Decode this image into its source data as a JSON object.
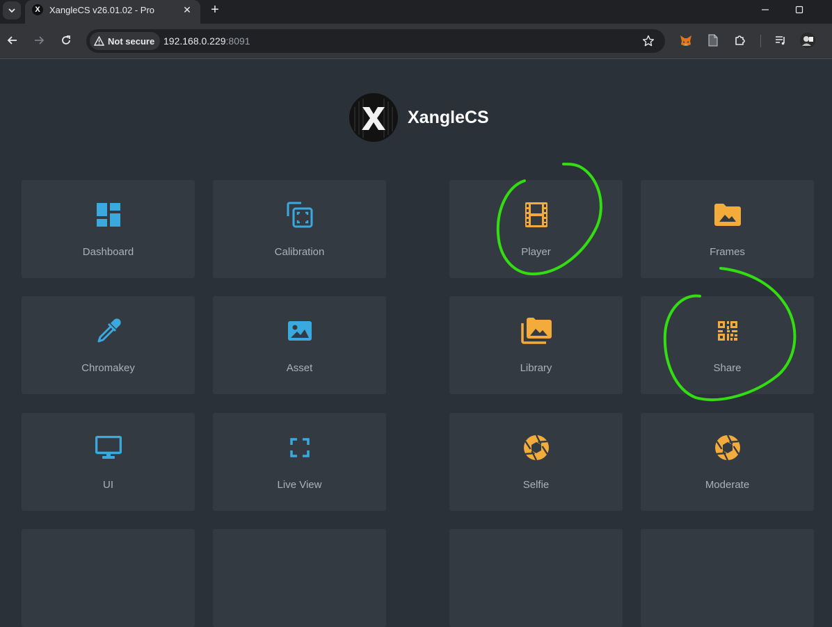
{
  "browser": {
    "tab_title": "XangleCS v26.01.02 - Pro",
    "url_host": "192.168.0.229",
    "url_port": ":8091",
    "security_label": "Not secure"
  },
  "brand": {
    "name": "XangleCS"
  },
  "tiles": [
    {
      "label": "Dashboard",
      "icon": "dashboard-icon",
      "color": "#3aa9e0"
    },
    {
      "label": "Calibration",
      "icon": "calibration-icon",
      "color": "#3aa9e0"
    },
    {
      "label": "Player",
      "icon": "film-icon",
      "color": "#f3ab3c"
    },
    {
      "label": "Frames",
      "icon": "folder-image-icon",
      "color": "#f3ab3c"
    },
    {
      "label": "Chromakey",
      "icon": "eyedropper-icon",
      "color": "#3aa9e0"
    },
    {
      "label": "Asset",
      "icon": "image-icon",
      "color": "#3aa9e0"
    },
    {
      "label": "Library",
      "icon": "photo-library-icon",
      "color": "#f3ab3c"
    },
    {
      "label": "Share",
      "icon": "qr-code-icon",
      "color": "#f3ab3c"
    },
    {
      "label": "UI",
      "icon": "monitor-icon",
      "color": "#3aa9e0"
    },
    {
      "label": "Live View",
      "icon": "fullscreen-icon",
      "color": "#3aa9e0"
    },
    {
      "label": "Selfie",
      "icon": "camera-aperture-icon",
      "color": "#f3ab3c"
    },
    {
      "label": "Moderate",
      "icon": "camera-aperture-icon",
      "color": "#f3ab3c"
    }
  ],
  "annotations": {
    "color": "#33dd11",
    "circled_items": [
      "Player",
      "Share"
    ]
  }
}
